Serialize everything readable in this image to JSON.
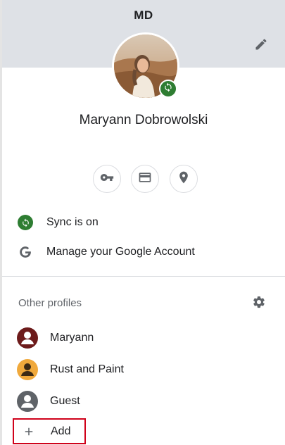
{
  "header": {
    "initials": "MD"
  },
  "user": {
    "name": "Maryann Dobrowolski"
  },
  "quick_actions": [
    {
      "icon": "key-icon"
    },
    {
      "icon": "credit-card-icon"
    },
    {
      "icon": "location-pin-icon"
    }
  ],
  "menu": {
    "sync_label": "Sync is on",
    "manage_label": "Manage your Google Account"
  },
  "other_profiles": {
    "title": "Other profiles",
    "profiles": [
      {
        "name": "Maryann",
        "color": "#6d1b1b"
      },
      {
        "name": "Rust and Paint",
        "color": "#f0a93c"
      },
      {
        "name": "Guest",
        "color": "#5f6368"
      }
    ],
    "add_label": "Add"
  },
  "colors": {
    "header_bg": "#dee1e6",
    "sync_green": "#2e7d32",
    "highlight_red": "#d0021b"
  }
}
